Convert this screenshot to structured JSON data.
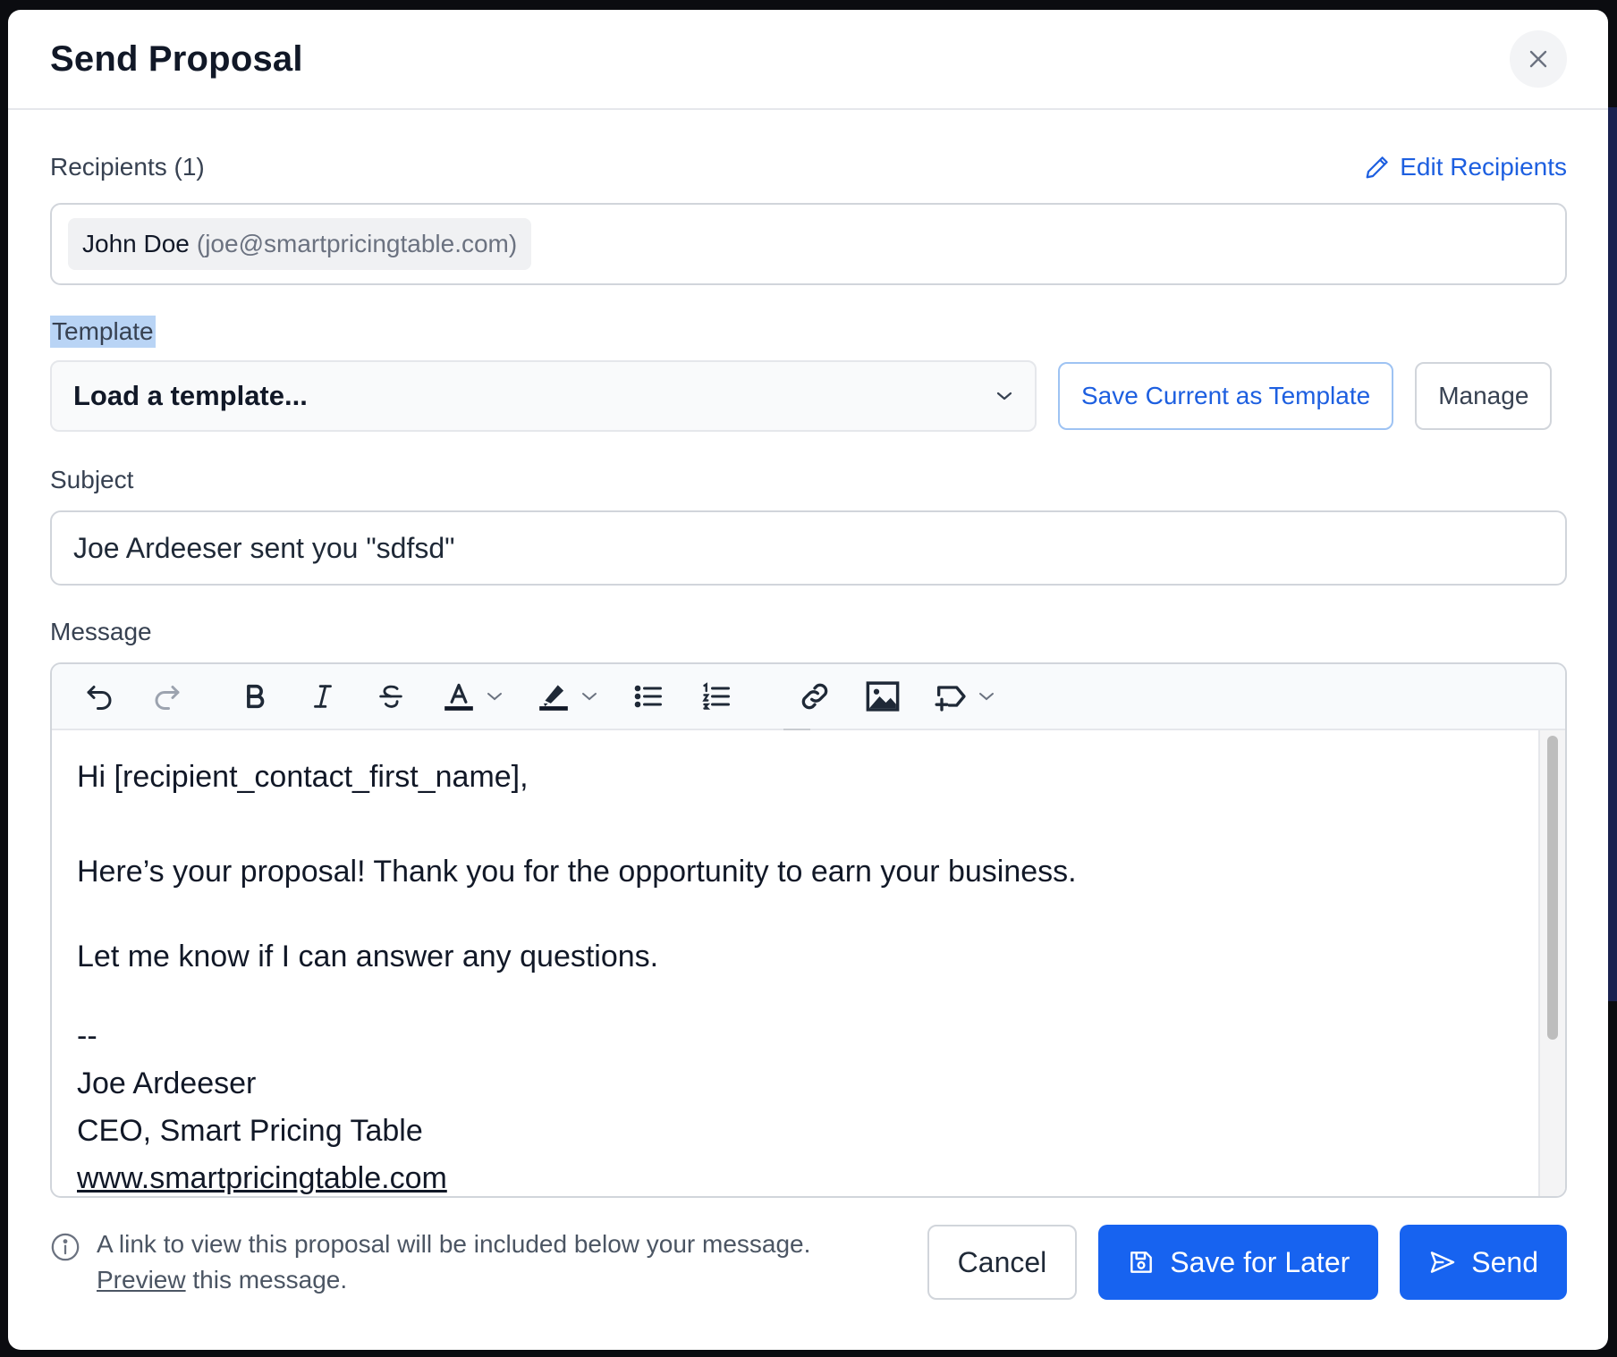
{
  "dialog": {
    "title": "Send Proposal",
    "close_icon": "close-icon"
  },
  "recipients": {
    "label": "Recipients (1)",
    "edit_label": "Edit Recipients",
    "edit_icon": "pencil-icon",
    "items": [
      {
        "name": "John Doe",
        "email": "(joe@smartpricingtable.com)"
      }
    ]
  },
  "template": {
    "label": "Template",
    "select_value": "Load a template...",
    "save_label": "Save Current as Template",
    "manage_label": "Manage"
  },
  "subject": {
    "label": "Subject",
    "value": "Joe Ardeeser sent you \"sdfsd\""
  },
  "message": {
    "label": "Message",
    "toolbar": [
      "undo-icon",
      "redo-icon",
      "bold-icon",
      "italic-icon",
      "strikethrough-icon",
      "text-color-icon",
      "highlight-icon",
      "bullet-list-icon",
      "numbered-list-icon",
      "link-icon",
      "image-icon",
      "merge-tag-icon"
    ],
    "lines": {
      "greeting": "Hi [recipient_contact_first_name],",
      "body1": "Here’s your proposal! Thank you for the opportunity to earn your business.",
      "body2": "Let me know if I can answer any questions.",
      "sig_sep": "--",
      "sig_name": "Joe Ardeeser",
      "sig_title": "CEO, Smart Pricing Table",
      "sig_url": "www.smartpricingtable.com"
    }
  },
  "footer": {
    "note": "A link to view this proposal will be included below your message.",
    "preview_link": "Preview",
    "preview_suffix": " this message.",
    "cancel_label": "Cancel",
    "save_later_label": "Save for Later",
    "send_label": "Send"
  },
  "colors": {
    "primary": "#1763f0",
    "link": "#1d5fe0",
    "highlight": "#b9d4f5"
  }
}
